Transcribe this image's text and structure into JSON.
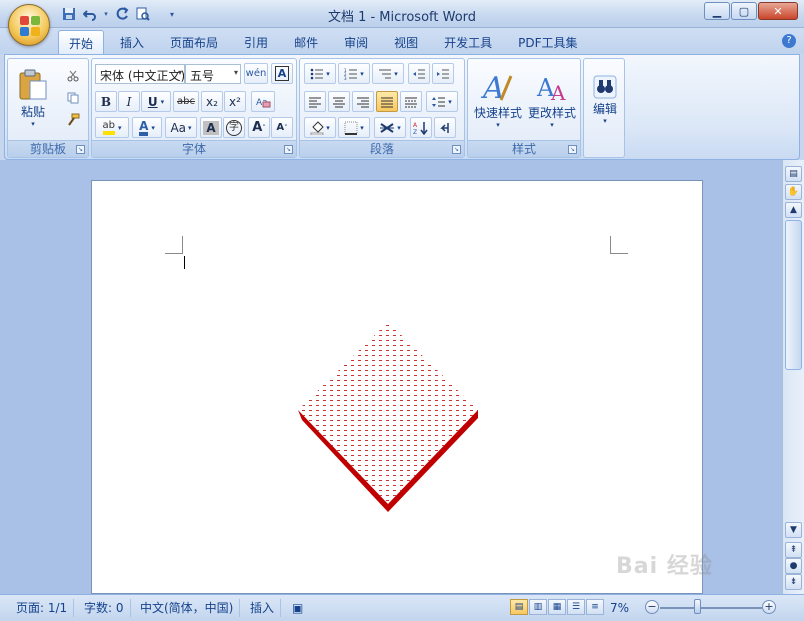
{
  "window": {
    "title": "文档 1 - Microsoft Word"
  },
  "qat": {
    "icons": [
      "save-icon",
      "undo-icon",
      "redo-icon",
      "print-preview-icon",
      "customize-icon"
    ]
  },
  "tabs": [
    "开始",
    "插入",
    "页面布局",
    "引用",
    "邮件",
    "审阅",
    "视图",
    "开发工具",
    "PDF工具集"
  ],
  "active_tab": "开始",
  "ribbon": {
    "clipboard": {
      "label": "剪贴板",
      "paste_label": "粘贴"
    },
    "font": {
      "label": "字体",
      "font_name": "宋体 (中文正文)",
      "font_size": "五号",
      "bold": "B",
      "italic": "I",
      "underline": "U",
      "strikethrough": "abc",
      "subscript": "x₂",
      "superscript": "x²",
      "change_case": "Aa",
      "grow": "A",
      "shrink": "A",
      "char_shading": "A",
      "enclose": "字"
    },
    "paragraph": {
      "label": "段落"
    },
    "styles": {
      "label": "样式",
      "quick_styles": "快速样式",
      "change_styles": "更改样式"
    },
    "editing": {
      "label": "编辑"
    }
  },
  "document": {
    "shape": {
      "type": "diamond",
      "fill": "red dot pattern",
      "shadow_color": "#c00000"
    }
  },
  "statusbar": {
    "page": "页面: 1/1",
    "words": "字数: 0",
    "language": "中文(简体，中国)",
    "mode": "插入",
    "zoom": "7%"
  },
  "watermark": "Bai 经验",
  "colors": {
    "accent": "#15428b",
    "shape_red": "#c00000",
    "highlight": "#ffe000",
    "font_color": "#2f5ea8"
  }
}
